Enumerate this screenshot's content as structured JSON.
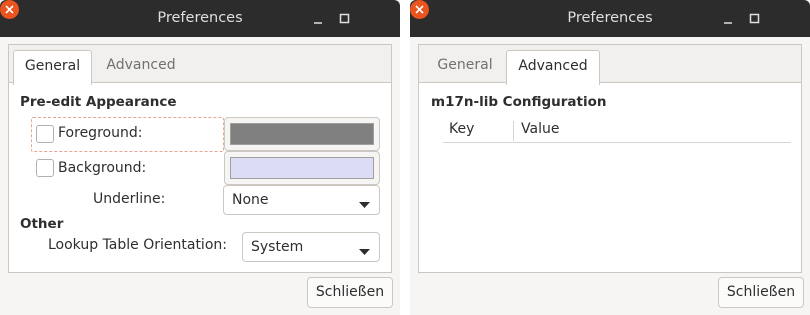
{
  "left_dialog": {
    "title": "Preferences",
    "tabs": [
      {
        "label": "General",
        "active": true
      },
      {
        "label": "Advanced",
        "active": false
      }
    ],
    "pre_edit": {
      "heading": "Pre-edit Appearance",
      "foreground_label": "Foreground:",
      "foreground_checked": false,
      "foreground_color": "#808080",
      "background_label": "Background:",
      "background_checked": false,
      "background_color": "#dcdcf4",
      "underline_label": "Underline:",
      "underline_value": "None"
    },
    "other": {
      "heading": "Other",
      "orientation_label": "Lookup Table Orientation:",
      "orientation_value": "System"
    },
    "close_label": "Schließen"
  },
  "right_dialog": {
    "title": "Preferences",
    "tabs": [
      {
        "label": "General",
        "active": false
      },
      {
        "label": "Advanced",
        "active": true
      }
    ],
    "heading": "m17n-lib Configuration",
    "columns": [
      "Key",
      "Value"
    ],
    "close_label": "Schließen"
  },
  "colors": {
    "titlebar": "#2c2c2c",
    "close_accent": "#e9541f",
    "focus_ring": "#e6a595"
  }
}
